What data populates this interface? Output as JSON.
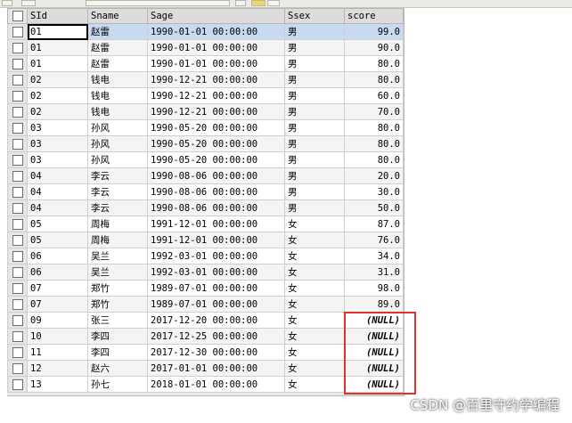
{
  "columns": [
    "SId",
    "Sname",
    "Sage",
    "Ssex",
    "score"
  ],
  "rows": [
    {
      "sid": "01",
      "sname": "赵雷",
      "sage": "1990-01-01 00:00:00",
      "ssex": "男",
      "score": "99.0"
    },
    {
      "sid": "01",
      "sname": "赵雷",
      "sage": "1990-01-01 00:00:00",
      "ssex": "男",
      "score": "90.0"
    },
    {
      "sid": "01",
      "sname": "赵雷",
      "sage": "1990-01-01 00:00:00",
      "ssex": "男",
      "score": "80.0"
    },
    {
      "sid": "02",
      "sname": "钱电",
      "sage": "1990-12-21 00:00:00",
      "ssex": "男",
      "score": "80.0"
    },
    {
      "sid": "02",
      "sname": "钱电",
      "sage": "1990-12-21 00:00:00",
      "ssex": "男",
      "score": "60.0"
    },
    {
      "sid": "02",
      "sname": "钱电",
      "sage": "1990-12-21 00:00:00",
      "ssex": "男",
      "score": "70.0"
    },
    {
      "sid": "03",
      "sname": "孙风",
      "sage": "1990-05-20 00:00:00",
      "ssex": "男",
      "score": "80.0"
    },
    {
      "sid": "03",
      "sname": "孙风",
      "sage": "1990-05-20 00:00:00",
      "ssex": "男",
      "score": "80.0"
    },
    {
      "sid": "03",
      "sname": "孙风",
      "sage": "1990-05-20 00:00:00",
      "ssex": "男",
      "score": "80.0"
    },
    {
      "sid": "04",
      "sname": "李云",
      "sage": "1990-08-06 00:00:00",
      "ssex": "男",
      "score": "20.0"
    },
    {
      "sid": "04",
      "sname": "李云",
      "sage": "1990-08-06 00:00:00",
      "ssex": "男",
      "score": "30.0"
    },
    {
      "sid": "04",
      "sname": "李云",
      "sage": "1990-08-06 00:00:00",
      "ssex": "男",
      "score": "50.0"
    },
    {
      "sid": "05",
      "sname": "周梅",
      "sage": "1991-12-01 00:00:00",
      "ssex": "女",
      "score": "87.0"
    },
    {
      "sid": "05",
      "sname": "周梅",
      "sage": "1991-12-01 00:00:00",
      "ssex": "女",
      "score": "76.0"
    },
    {
      "sid": "06",
      "sname": "吴兰",
      "sage": "1992-03-01 00:00:00",
      "ssex": "女",
      "score": "34.0"
    },
    {
      "sid": "06",
      "sname": "吴兰",
      "sage": "1992-03-01 00:00:00",
      "ssex": "女",
      "score": "31.0"
    },
    {
      "sid": "07",
      "sname": "郑竹",
      "sage": "1989-07-01 00:00:00",
      "ssex": "女",
      "score": "98.0"
    },
    {
      "sid": "07",
      "sname": "郑竹",
      "sage": "1989-07-01 00:00:00",
      "ssex": "女",
      "score": "89.0"
    },
    {
      "sid": "09",
      "sname": "张三",
      "sage": "2017-12-20 00:00:00",
      "ssex": "女",
      "score": "(NULL)"
    },
    {
      "sid": "10",
      "sname": "李四",
      "sage": "2017-12-25 00:00:00",
      "ssex": "女",
      "score": "(NULL)"
    },
    {
      "sid": "11",
      "sname": "李四",
      "sage": "2017-12-30 00:00:00",
      "ssex": "女",
      "score": "(NULL)"
    },
    {
      "sid": "12",
      "sname": "赵六",
      "sage": "2017-01-01 00:00:00",
      "ssex": "女",
      "score": "(NULL)"
    },
    {
      "sid": "13",
      "sname": "孙七",
      "sage": "2018-01-01 00:00:00",
      "ssex": "女",
      "score": "(NULL)"
    }
  ],
  "selected_row": 0,
  "null_text": "(NULL)",
  "colors": {
    "highlight_box": "#e0322b",
    "selection": "#c8daf2"
  },
  "watermark": "CSDN @百里守约学编程"
}
